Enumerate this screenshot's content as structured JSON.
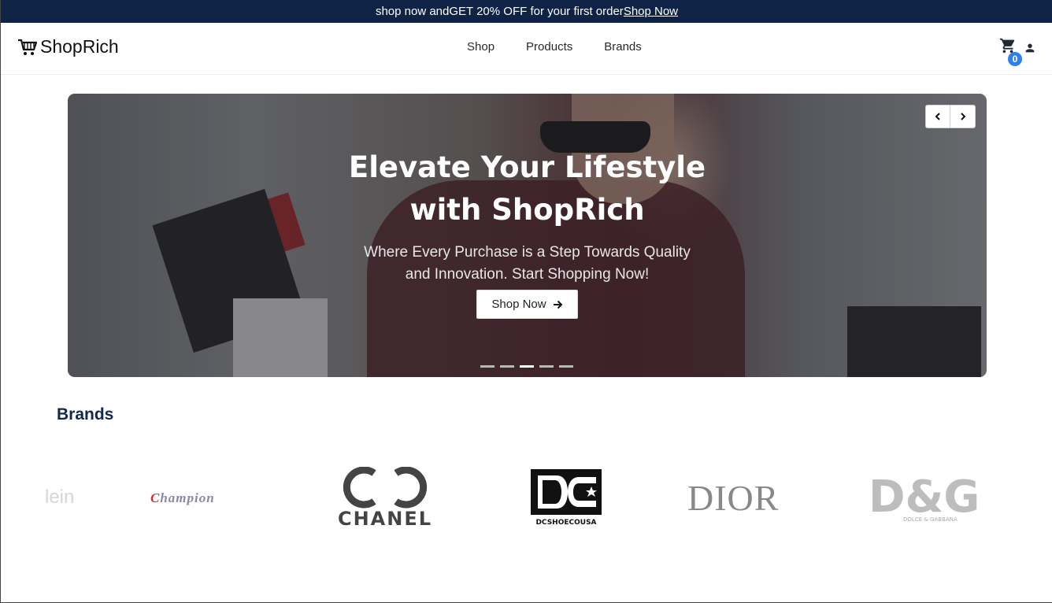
{
  "promo": {
    "text": "shop now andGET 20% OFF for your first order",
    "link": "Shop Now"
  },
  "header": {
    "brand": "ShopRich",
    "nav": [
      "Shop",
      "Products",
      "Brands"
    ],
    "cart_count": "0"
  },
  "hero": {
    "title_line1": "Elevate Your Lifestyle",
    "title_line2": "with ShopRich",
    "subtitle_line1": "Where Every Purchase is a Step Towards Quality",
    "subtitle_line2": "and Innovation. Start Shopping Now!",
    "button": "Shop Now",
    "slides": 5,
    "active_slide": 3
  },
  "brands": {
    "title": "Brands",
    "logos": {
      "klein": "lein",
      "champion": "Champion",
      "chanel": "CHANEL",
      "dc": "DCSHOECOUSA",
      "dior": "DIOR",
      "dg": "D&G",
      "dg_sub": "DOLCE & GABBANA"
    }
  },
  "colors": {
    "promo_bg": "#0f2347",
    "badge": "#2f80ed",
    "brands_title": "#14274e"
  },
  "icons": [
    "cart-icon",
    "user-icon",
    "chevron-left-icon",
    "chevron-right-icon",
    "arrow-right-icon"
  ]
}
